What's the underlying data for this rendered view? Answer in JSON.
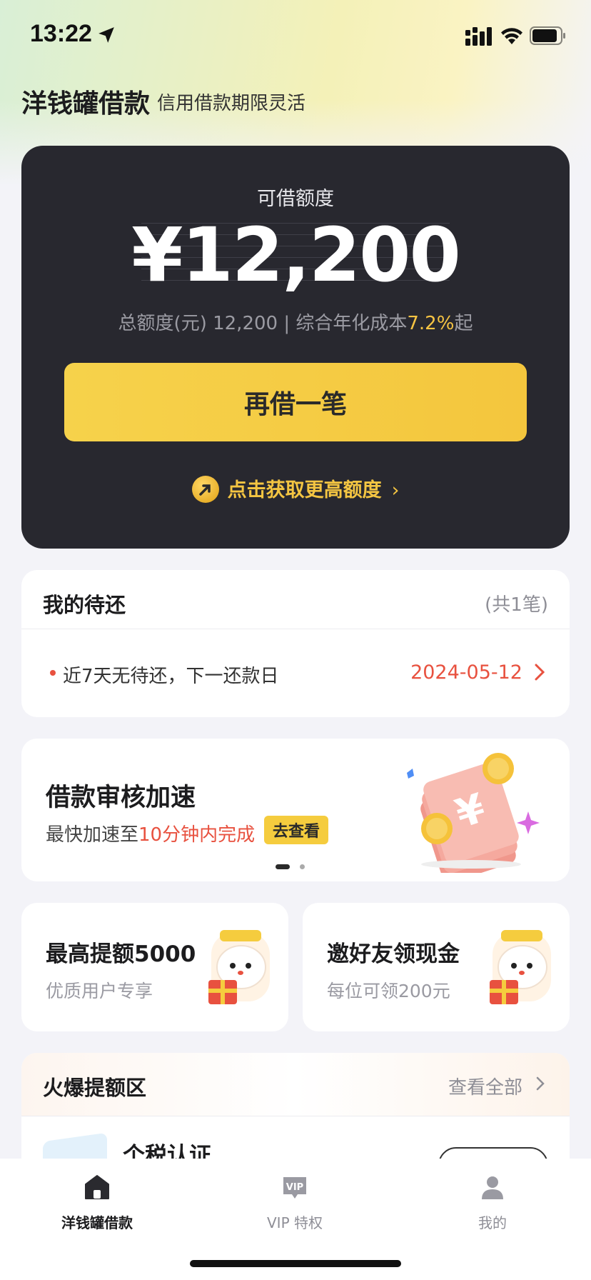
{
  "status_bar": {
    "time": "13:22",
    "icons": [
      "location-arrow-icon",
      "cellular-signal-icon",
      "wifi-icon",
      "battery-icon"
    ]
  },
  "header": {
    "title": "洋钱罐借款",
    "subtitle": "信用借款期限灵活"
  },
  "credit": {
    "label": "可借额度",
    "amount": "¥12,200",
    "info_prefix": "总额度(元) 12,200 | 综合年化成本",
    "rate": "7.2%",
    "info_suffix": "起",
    "borrow_button": "再借一笔",
    "boost_link": "点击获取更高额度",
    "accent_color": "#F5CC3E",
    "card_color": "#28282F"
  },
  "pending": {
    "title": "我的待还",
    "count": "(共1笔)",
    "text": "近7天无待还，下一还款日",
    "date": "2024-05-12",
    "date_color": "#E8513F"
  },
  "promo": {
    "title": "借款审核加速",
    "desc_prefix": "最快加速至",
    "desc_highlight": "10分钟内完成",
    "button": "去查看",
    "carousel_total": 2,
    "carousel_active": 1
  },
  "mini_cards": [
    {
      "title": "最高提额5000",
      "subtitle": "优质用户专享"
    },
    {
      "title": "邀好友领现金",
      "subtitle": "每位可领200元"
    }
  ],
  "hot_zone": {
    "title": "火爆提额区",
    "link": "查看全部",
    "item_title": "个税认证"
  },
  "tab_bar": {
    "items": [
      {
        "label": "洋钱罐借款",
        "icon": "home-icon",
        "active": true
      },
      {
        "label": "VIP 特权",
        "icon": "vip-icon",
        "active": false
      },
      {
        "label": "我的",
        "icon": "profile-icon",
        "active": false
      }
    ]
  }
}
